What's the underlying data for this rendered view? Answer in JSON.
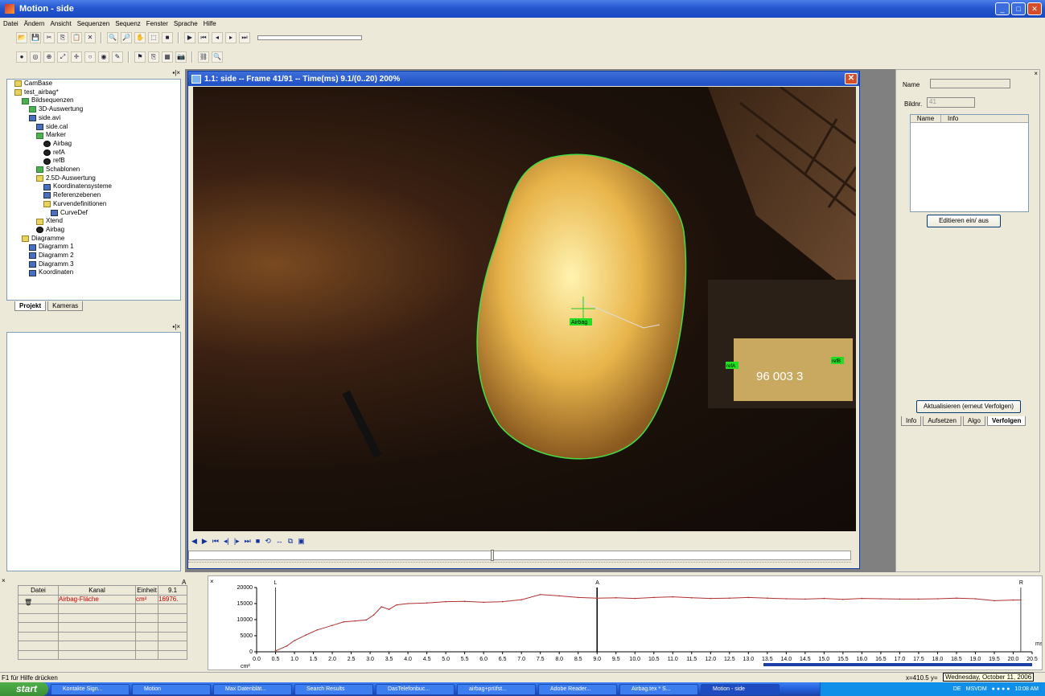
{
  "window": {
    "title": "Motion - side",
    "min": "_",
    "max": "□",
    "close": "✕"
  },
  "menu": [
    "Datei",
    "Ändern",
    "Ansicht",
    "Sequenzen",
    "Sequenz",
    "Fenster",
    "Sprache",
    "Hilfe"
  ],
  "toolbar1_icons": [
    "folder-open",
    "save",
    "cut",
    "copy",
    "paste",
    "delete",
    "find",
    "zoom",
    "hand",
    "select",
    "stop",
    "play",
    "rewind",
    "prev",
    "next",
    "end"
  ],
  "toolbar2_icons": [
    "circle",
    "target",
    "crosshair",
    "arrows",
    "cross",
    "ring",
    "dot",
    "pen",
    "flag",
    "copy",
    "grid",
    "camera",
    "link",
    "search"
  ],
  "tree": {
    "items": [
      {
        "label": "CamBase",
        "indent": 1,
        "icon": "folder"
      },
      {
        "label": "test_airbag*",
        "indent": 1,
        "icon": "folder"
      },
      {
        "label": "Bildsequenzen",
        "indent": 2,
        "icon": "folder-green"
      },
      {
        "label": "3D-Auswertung",
        "indent": 3,
        "icon": "folder-green"
      },
      {
        "label": "side.avi",
        "indent": 3,
        "icon": "film"
      },
      {
        "label": "side.cal",
        "indent": 4,
        "icon": "camera"
      },
      {
        "label": "Marker",
        "indent": 4,
        "icon": "folder-green"
      },
      {
        "label": "Airbag",
        "indent": 5,
        "icon": "marker"
      },
      {
        "label": "refA",
        "indent": 5,
        "icon": "marker"
      },
      {
        "label": "refB",
        "indent": 5,
        "icon": "marker"
      },
      {
        "label": "Schablonen",
        "indent": 4,
        "icon": "folder-green"
      },
      {
        "label": "2.5D-Auswertung",
        "indent": 4,
        "icon": "folder"
      },
      {
        "label": "Koordinatensysteme",
        "indent": 5,
        "icon": "axes"
      },
      {
        "label": "Referenzebenen",
        "indent": 5,
        "icon": "axes"
      },
      {
        "label": "Kurvendefinitionen",
        "indent": 5,
        "icon": "folder"
      },
      {
        "label": "CurveDef",
        "indent": 6,
        "icon": "axes"
      },
      {
        "label": "Xtend",
        "indent": 4,
        "icon": "folder"
      },
      {
        "label": "Airbag",
        "indent": 4,
        "icon": "marker"
      },
      {
        "label": "Diagramme",
        "indent": 2,
        "icon": "folder"
      },
      {
        "label": "Diagramm 1",
        "indent": 3,
        "icon": "chart"
      },
      {
        "label": "Diagramm 2",
        "indent": 3,
        "icon": "chart"
      },
      {
        "label": "Diagramm 3",
        "indent": 3,
        "icon": "chart"
      },
      {
        "label": "Koordinaten",
        "indent": 3,
        "icon": "chart"
      }
    ]
  },
  "left_tabs": {
    "project": "Projekt",
    "cameras": "Kameras"
  },
  "video": {
    "title": "1.1: side -- Frame 41/91 -- Time(ms) 9.1/(0..20) 200%",
    "markers": {
      "airbag": "Airbag",
      "refA": "refA",
      "refB": "refB"
    },
    "plate_text": "96 003 3"
  },
  "right": {
    "name_label": "Name",
    "bildnr_label": "Bildnr.",
    "bildnr_value": "41",
    "col_name": "Name",
    "col_info": "Info",
    "edit_btn": "Editieren ein/ aus",
    "update_btn": "Aktualisieren (erneut Verfolgen)",
    "tabs": [
      "Info",
      "Aufsetzen",
      "Algo",
      "Verfolgen"
    ]
  },
  "channels": {
    "col_a": "A",
    "headers": [
      "Datei",
      "Kanal",
      "Einheit",
      "9.1"
    ],
    "row": {
      "file": "",
      "channel": "Airbag-Fläche",
      "unit": "cm²",
      "value": "16976."
    }
  },
  "plot": {
    "label_l": "L",
    "label_a": "A",
    "label_r": "R",
    "xunit": "ms",
    "yunit": "cm²"
  },
  "chart_data": {
    "type": "line",
    "title": "",
    "xlabel": "ms",
    "ylabel": "cm²",
    "xlim": [
      0,
      20.5
    ],
    "ylim": [
      0,
      20000
    ],
    "x_ticks": [
      "0.0",
      "0.5",
      "1.0",
      "1.5",
      "2.0",
      "2.5",
      "3.0",
      "3.5",
      "4.0",
      "4.5",
      "5.0",
      "5.5",
      "6.0",
      "6.5",
      "7.0",
      "7.5",
      "8.0",
      "8.5",
      "9.0",
      "9.5",
      "10.0",
      "10.5",
      "11.0",
      "11.5",
      "12.0",
      "12.5",
      "13.0",
      "13.5",
      "14.0",
      "14.5",
      "15.0",
      "15.5",
      "16.0",
      "16.5",
      "17.0",
      "17.5",
      "18.0",
      "18.5",
      "19.0",
      "19.5",
      "20.0",
      "20.5"
    ],
    "y_ticks": [
      "0",
      "5000",
      "10000",
      "15000",
      "20000"
    ],
    "series": [
      {
        "name": "Airbag-Fläche",
        "color": "#b03030",
        "x": [
          0.5,
          0.8,
          1.0,
          1.3,
          1.6,
          2.0,
          2.3,
          2.6,
          2.9,
          3.1,
          3.3,
          3.5,
          3.7,
          4.0,
          4.5,
          5.0,
          5.5,
          6.0,
          6.5,
          7.0,
          7.5,
          8.0,
          8.5,
          9.0,
          9.5,
          10.0,
          10.5,
          11.0,
          11.5,
          12.0,
          12.5,
          13.0,
          13.5,
          14.0,
          14.5,
          15.0,
          15.5,
          16.0,
          16.5,
          17.0,
          17.5,
          18.0,
          18.5,
          19.0,
          19.5,
          20.0,
          20.2
        ],
        "y": [
          300,
          1800,
          3500,
          5200,
          6800,
          8200,
          9300,
          9600,
          9900,
          11500,
          14000,
          13200,
          14600,
          15000,
          15200,
          15600,
          15700,
          15400,
          15600,
          16200,
          17800,
          17400,
          16900,
          16700,
          16800,
          16600,
          16900,
          17100,
          16800,
          16600,
          16700,
          16900,
          16700,
          16500,
          16400,
          16600,
          16300,
          16600,
          16500,
          16400,
          16400,
          16500,
          16700,
          16500,
          15900,
          16100,
          16100
        ]
      }
    ],
    "cursors": {
      "L": 0.5,
      "A": 9.0,
      "R": 20.2
    }
  },
  "status": {
    "help": "F1 für Hilfe drücken",
    "coords": "x=410.5 y=",
    "date": "Wednesday, October 11, 2006"
  },
  "taskbar": {
    "start": "start",
    "items": [
      "Kontakte Sign...",
      "Motion",
      "Max Datenblät...",
      "Search Results",
      "DasTelefonbuc...",
      "airbag+prüfst...",
      "Adobe Reader...",
      "Airbag.tex * S...",
      "Motion - side"
    ],
    "lang": "DE",
    "tray_app": "MSVDM",
    "time": "10:08 AM"
  }
}
